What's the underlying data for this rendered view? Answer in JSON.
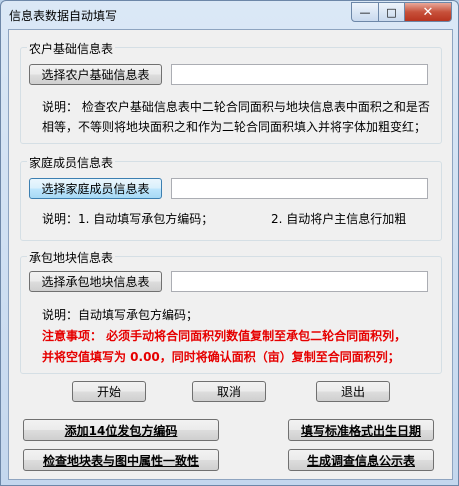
{
  "window": {
    "title": "信息表数据自动填写",
    "minimize": "—",
    "maximize": "□",
    "close": "✕"
  },
  "group1": {
    "title": "农户基础信息表",
    "button": "选择农户基础信息表",
    "input_value": "",
    "note_line1": "说明：  检查农户基础信息表中二轮合同面积与地块信息表中面积之和是否",
    "note_line2": "相等，不等则将地块面积之和作为二轮合同面积填入并将字体加粗变红；"
  },
  "group2": {
    "title": "家庭成员信息表",
    "button": "选择家庭成员信息表",
    "input_value": "",
    "note1": "说明：1.  自动填写承包方编码；",
    "note2": "2.  自动将户主信息行加粗"
  },
  "group3": {
    "title": "承包地块信息表",
    "button": "选择承包地块信息表",
    "input_value": "",
    "note": "说明：自动填写承包方编码；",
    "warning_line1": "注意事项：  必须手动将合同面积列数值复制至承包二轮合同面积列，",
    "warning_line2": "并将空值填写为 0.00，同时将确认面积（亩）复制至合同面积列；"
  },
  "actions": {
    "start": "开始",
    "cancel": "取消",
    "exit": "退出"
  },
  "tools": {
    "add_code": "添加14位发包方编码",
    "birthdate": "填写标准格式出生日期",
    "check_consistency": "检查地块表与图中属性一致性",
    "generate_notice": "生成调查信息公示表"
  }
}
